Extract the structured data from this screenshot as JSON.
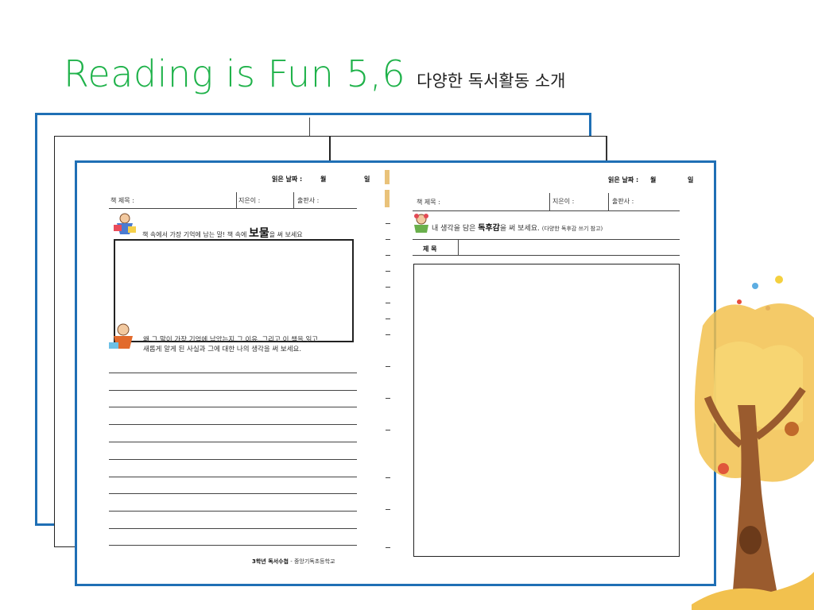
{
  "slide": {
    "title_main": "Reading is Fun 5,6",
    "title_sub": "다양한 독서활동 소개"
  },
  "left_sheet": {
    "date_label": "읽은 날짜 :",
    "month": "월",
    "day": "일",
    "book_title_label": "책 제목 :",
    "author_label": "지은이 :",
    "publisher_label": "출판사 :",
    "prompt1_pre": "책 속에서 가장 기억에 남는 말! 책 속에",
    "prompt1_big": "보물",
    "prompt1_post": "을 써 보세요",
    "prompt2_line1": "왜 그 말이 가장 기억에 남았는지 그 이유, 그리고 이 책을 읽고",
    "prompt2_line2": "새롭게 알게 된 사실과 그에 대한   나의 생각을 써 보세요.",
    "footer_bold": "3학년 독서수첩",
    "footer_rest": "- 중앙기독초등학교"
  },
  "right_sheet": {
    "date_label": "읽은 날짜 :",
    "month": "월",
    "day": "일",
    "book_title_label": "책 제목 :",
    "author_label": "지은이 :",
    "publisher_label": "출판사 :",
    "prompt_pre": "내 생각을 담은",
    "prompt_bold": "독후감",
    "prompt_post": "을 써 보세요.",
    "prompt_hint": "(다양한 독후감 쓰기 참고)",
    "subject_label": "제  목"
  },
  "colors": {
    "title_green": "#1fb24a",
    "frame_blue": "#1f6fb5"
  }
}
